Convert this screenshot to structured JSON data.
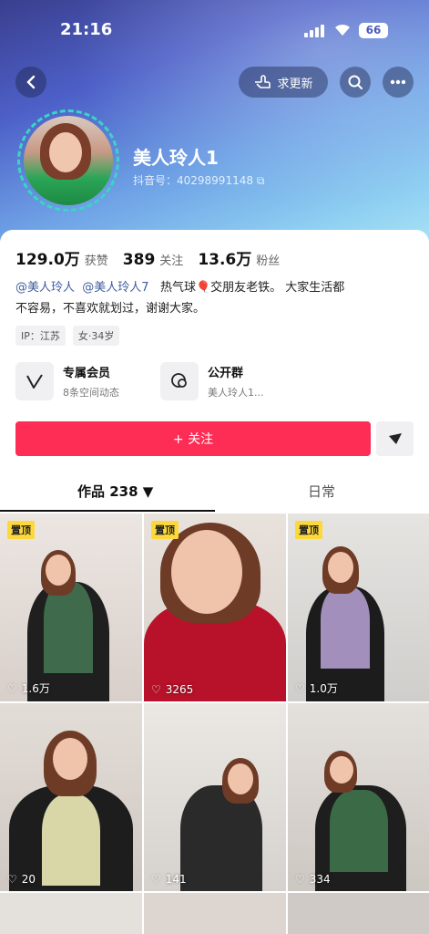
{
  "status": {
    "time": "21:16",
    "battery": "66"
  },
  "topbar": {
    "update_label": "求更新"
  },
  "profile": {
    "name": "美人玲人1",
    "douyin_id": "抖音号：40298991148"
  },
  "stats": [
    {
      "value": "129.0万",
      "label": "获赞"
    },
    {
      "value": "389",
      "label": "关注"
    },
    {
      "value": "13.6万",
      "label": "粉丝"
    }
  ],
  "bio": {
    "mention1": "@美人玲人",
    "mention2": "@美人玲人7",
    "text1": "热气球🎈交朋友老铁。 大家生活都",
    "text2": "不容易，不喜欢就划过，谢谢大家。"
  },
  "tags": [
    "IP：江苏",
    "女·34岁"
  ],
  "features": [
    {
      "title": "专属会员",
      "subtitle": "8条空间动态"
    },
    {
      "title": "公开群",
      "subtitle": "美人玲人1..."
    }
  ],
  "follow_label": "+ 关注",
  "tabs": {
    "works": "作品 238",
    "daily": "日常"
  },
  "grid": {
    "pin_label": "置顶",
    "tiles": [
      {
        "likes": "1.6万",
        "pinned": true
      },
      {
        "likes": "3265",
        "pinned": true
      },
      {
        "likes": "1.0万",
        "pinned": true
      },
      {
        "likes": "20",
        "pinned": false
      },
      {
        "likes": "141",
        "pinned": false
      },
      {
        "likes": "334",
        "pinned": false
      }
    ]
  },
  "colors": {
    "accent": "#fd2d55",
    "pin": "#fdd83a",
    "mention": "#3d5d9e"
  }
}
